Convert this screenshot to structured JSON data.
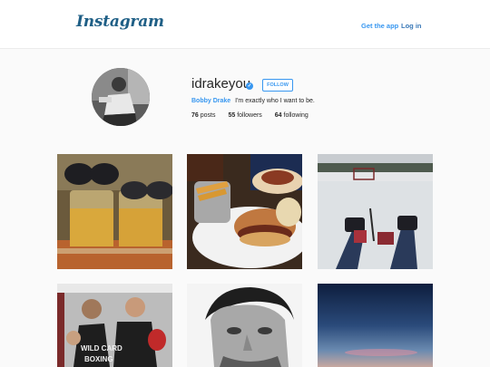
{
  "header": {
    "logo": "Instagram",
    "get_app": "Get the app",
    "login": "Log in"
  },
  "profile": {
    "username": "idrakeyou",
    "verified_glyph": "✓",
    "follow_label": "FOLLOW",
    "full_name": "Bobby Drake",
    "bio": "I'm exactly who I want to be.",
    "posts_count": "76",
    "posts_label": "posts",
    "followers_count": "55",
    "followers_label": "followers",
    "following_count": "64",
    "following_label": "following"
  },
  "tiles": [
    {
      "subject": "beer-mugs-sunglasses-photo"
    },
    {
      "subject": "burger-fries-photo"
    },
    {
      "subject": "frozen-lake-hockey-photo"
    },
    {
      "subject": "boxing-gym-photo"
    },
    {
      "subject": "bw-portrait-photo"
    },
    {
      "subject": "sunset-sky-photo"
    }
  ],
  "colors": {
    "accent": "#3897f0",
    "logo": "#1f5f86"
  }
}
